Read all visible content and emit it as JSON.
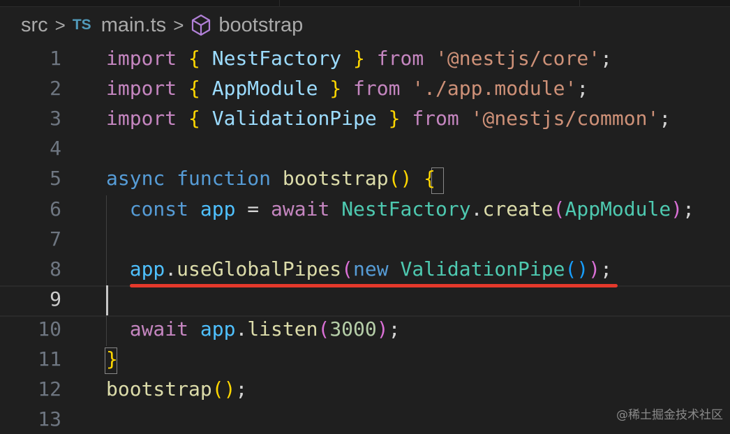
{
  "breadcrumb": {
    "folder": "src",
    "file_icon": "TS",
    "file": "main.ts",
    "symbol_icon": "cube-icon",
    "symbol": "bootstrap"
  },
  "editor": {
    "active_line": 9,
    "lines": [
      {
        "n": "1",
        "tokens": [
          [
            "import",
            "k-ctrl"
          ],
          [
            " ",
            "plain"
          ],
          [
            "{",
            "br1"
          ],
          [
            " NestFactory ",
            "var"
          ],
          [
            "}",
            "br1"
          ],
          [
            " ",
            "plain"
          ],
          [
            "from",
            "k-ctrl"
          ],
          [
            " ",
            "plain"
          ],
          [
            "'@nestjs/core'",
            "str"
          ],
          [
            ";",
            "plain"
          ]
        ]
      },
      {
        "n": "2",
        "tokens": [
          [
            "import",
            "k-ctrl"
          ],
          [
            " ",
            "plain"
          ],
          [
            "{",
            "br1"
          ],
          [
            " AppModule ",
            "var"
          ],
          [
            "}",
            "br1"
          ],
          [
            " ",
            "plain"
          ],
          [
            "from",
            "k-ctrl"
          ],
          [
            " ",
            "plain"
          ],
          [
            "'./app.module'",
            "str"
          ],
          [
            ";",
            "plain"
          ]
        ]
      },
      {
        "n": "3",
        "tokens": [
          [
            "import",
            "k-ctrl"
          ],
          [
            " ",
            "plain"
          ],
          [
            "{",
            "br1"
          ],
          [
            " ValidationPipe ",
            "var"
          ],
          [
            "}",
            "br1"
          ],
          [
            " ",
            "plain"
          ],
          [
            "from",
            "k-ctrl"
          ],
          [
            " ",
            "plain"
          ],
          [
            "'@nestjs/common'",
            "str"
          ],
          [
            ";",
            "plain"
          ]
        ]
      },
      {
        "n": "4",
        "tokens": []
      },
      {
        "n": "5",
        "tokens": [
          [
            "async",
            "k-store"
          ],
          [
            " ",
            "plain"
          ],
          [
            "function",
            "k-store"
          ],
          [
            " ",
            "plain"
          ],
          [
            "bootstrap",
            "fn"
          ],
          [
            "()",
            "br1"
          ],
          [
            " ",
            "plain"
          ],
          [
            "{",
            "br1"
          ]
        ]
      },
      {
        "n": "6",
        "tokens": [
          [
            "  ",
            "plain"
          ],
          [
            "const",
            "k-store"
          ],
          [
            " ",
            "plain"
          ],
          [
            "app",
            "const"
          ],
          [
            " = ",
            "plain"
          ],
          [
            "await",
            "k-ctrl"
          ],
          [
            " ",
            "plain"
          ],
          [
            "NestFactory",
            "cls"
          ],
          [
            ".",
            "plain"
          ],
          [
            "create",
            "fn"
          ],
          [
            "(",
            "br2"
          ],
          [
            "AppModule",
            "cls"
          ],
          [
            ")",
            "br2"
          ],
          [
            ";",
            "plain"
          ]
        ]
      },
      {
        "n": "7",
        "tokens": []
      },
      {
        "n": "8",
        "tokens": [
          [
            "  ",
            "plain"
          ],
          [
            "app",
            "const"
          ],
          [
            ".",
            "plain"
          ],
          [
            "useGlobalPipes",
            "fn"
          ],
          [
            "(",
            "br2"
          ],
          [
            "new",
            "k-store"
          ],
          [
            " ",
            "plain"
          ],
          [
            "ValidationPipe",
            "cls"
          ],
          [
            "()",
            "br3"
          ],
          [
            ")",
            "br2"
          ],
          [
            ";",
            "plain"
          ]
        ]
      },
      {
        "n": "9",
        "tokens": []
      },
      {
        "n": "10",
        "tokens": [
          [
            "  ",
            "plain"
          ],
          [
            "await",
            "k-ctrl"
          ],
          [
            " ",
            "plain"
          ],
          [
            "app",
            "const"
          ],
          [
            ".",
            "plain"
          ],
          [
            "listen",
            "fn"
          ],
          [
            "(",
            "br2"
          ],
          [
            "3000",
            "num"
          ],
          [
            ")",
            "br2"
          ],
          [
            ";",
            "plain"
          ]
        ]
      },
      {
        "n": "11",
        "tokens": [
          [
            "}",
            "br1"
          ]
        ]
      },
      {
        "n": "12",
        "tokens": [
          [
            "bootstrap",
            "fn"
          ],
          [
            "()",
            "br1"
          ],
          [
            ";",
            "plain"
          ]
        ]
      },
      {
        "n": "13",
        "tokens": []
      }
    ]
  },
  "watermark": "@稀土掘金技术社区"
}
